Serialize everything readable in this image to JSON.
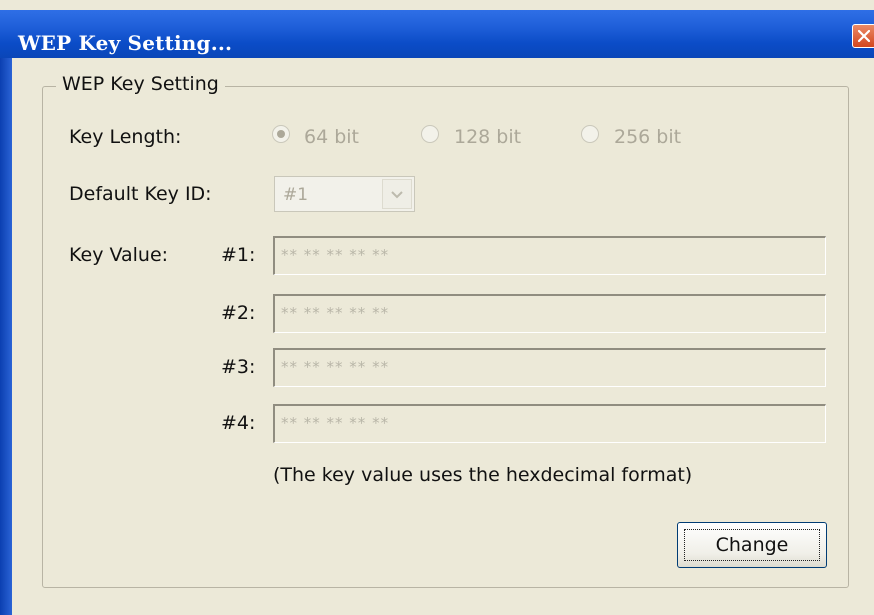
{
  "window": {
    "title": "WEP Key Setting...",
    "icons": {
      "close": "close-icon"
    }
  },
  "group": {
    "legend": "WEP Key Setting"
  },
  "key_length": {
    "label": "Key Length:",
    "options": [
      {
        "label": "64 bit",
        "checked": true
      },
      {
        "label": "128 bit",
        "checked": false
      },
      {
        "label": "256 bit",
        "checked": false
      }
    ]
  },
  "default_key": {
    "label": "Default Key ID:",
    "selected": "#1",
    "icon": "chevron-down-icon"
  },
  "key_value": {
    "label": "Key Value:",
    "keys": [
      {
        "label": "#1:",
        "value": "** ** ** ** **"
      },
      {
        "label": "#2:",
        "value": "** ** ** ** **"
      },
      {
        "label": "#3:",
        "value": "** ** ** ** **"
      },
      {
        "label": "#4:",
        "value": "** ** ** ** **"
      }
    ],
    "hint": "(The key value uses the hexdecimal format)"
  },
  "actions": {
    "change_label": "Change"
  },
  "colors": {
    "titlebar": "#0b4cc7",
    "dialog_bg": "#ece9d8",
    "disabled_text": "#aca899",
    "close_button": "#d2461f"
  }
}
